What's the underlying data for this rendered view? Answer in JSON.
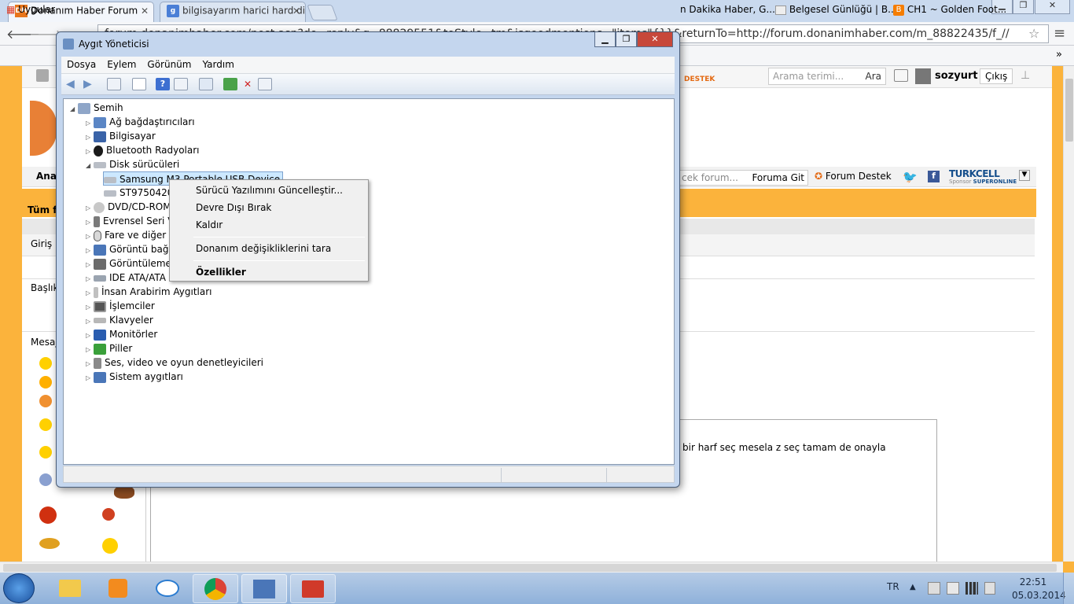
{
  "browser": {
    "tabs": [
      {
        "title": "Donanım Haber Forum",
        "favicon": "DH"
      },
      {
        "title": "bilgisayarım harici hard di"
      }
    ],
    "url": "forum.donanimhaber.com/post.asp?do=reply&q=88829551&toStyle=tm&isgoodmentions=\"items\"{}}&returnTo=http://forum.donanimhaber.com/m_88822435/f_//",
    "bookmarks": [
      {
        "label": "Uygular"
      },
      {
        "label": "n Dakika Haber, G..."
      },
      {
        "label": "Belgesel Günlüğü | B..."
      },
      {
        "label": "CH1 ~ Golden Foot..."
      }
    ]
  },
  "forum": {
    "search_placeholder": "Arama terimi...",
    "search_button": "Ara",
    "username": "sozyurt",
    "logout": "Çıkış",
    "destek_top": "DESTEK",
    "nav_left": "Ana",
    "forum_search_placeholder": "cek forum...",
    "forum_go": "Foruma Git",
    "forum_support": "Forum Destek",
    "turkcell": "TURKCELL",
    "sponsor": "Sponsor",
    "superonline": "SUPERONLINE",
    "all_forums": "Tüm f",
    "label_login": "Giriş",
    "label_title": "Başlık",
    "label_message": "Mesaj",
    "message_text": "bir harf seç  mesela z seç tamam de onayla"
  },
  "device_manager": {
    "title": "Aygıt Yöneticisi",
    "menu": [
      "Dosya",
      "Eylem",
      "Görünüm",
      "Yardım"
    ],
    "root": "Semih",
    "tree": [
      {
        "label": "Ağ bağdaştırıcıları",
        "icon": "network-icon"
      },
      {
        "label": "Bilgisayar",
        "icon": "computer-icon"
      },
      {
        "label": "Bluetooth Radyoları",
        "icon": "bluetooth-icon"
      },
      {
        "label": "Disk sürücüleri",
        "icon": "disk-icon",
        "expanded": true
      },
      {
        "label": "Samsung M3 Portable USB Device",
        "icon": "disk-icon",
        "child": true,
        "selected": true
      },
      {
        "label": "ST9750420",
        "icon": "disk-icon",
        "child": true
      },
      {
        "label": "DVD/CD-ROM",
        "icon": "dvd-icon"
      },
      {
        "label": "Evrensel Seri V",
        "icon": "usb-icon"
      },
      {
        "label": "Fare ve diğer",
        "icon": "mouse-icon"
      },
      {
        "label": "Görüntü bağd",
        "icon": "display-adapter-icon"
      },
      {
        "label": "Görüntüleme",
        "icon": "imaging-icon"
      },
      {
        "label": "IDE ATA/ATA",
        "icon": "ide-icon"
      },
      {
        "label": "İnsan Arabirim Aygıtları",
        "icon": "hid-icon"
      },
      {
        "label": "İşlemciler",
        "icon": "cpu-icon"
      },
      {
        "label": "Klavyeler",
        "icon": "keyboard-icon"
      },
      {
        "label": "Monitörler",
        "icon": "monitor-icon"
      },
      {
        "label": "Piller",
        "icon": "battery-icon"
      },
      {
        "label": "Ses, video ve oyun denetleyicileri",
        "icon": "speaker-icon"
      },
      {
        "label": "Sistem aygıtları",
        "icon": "system-icon"
      }
    ]
  },
  "context_menu": {
    "update_driver": "Sürücü Yazılımını Güncelleştir...",
    "disable": "Devre Dışı Bırak",
    "uninstall": "Kaldır",
    "scan": "Donanım değişikliklerini tara",
    "properties": "Özellikler"
  },
  "taskbar": {
    "lang": "TR",
    "time": "22:51",
    "date": "05.03.2014"
  },
  "colors": {
    "forum_orange": "#fbb33c",
    "selection": "#cce8ff",
    "window_frame": "#c4d6ee",
    "taskbar": "#a9c3e3"
  }
}
